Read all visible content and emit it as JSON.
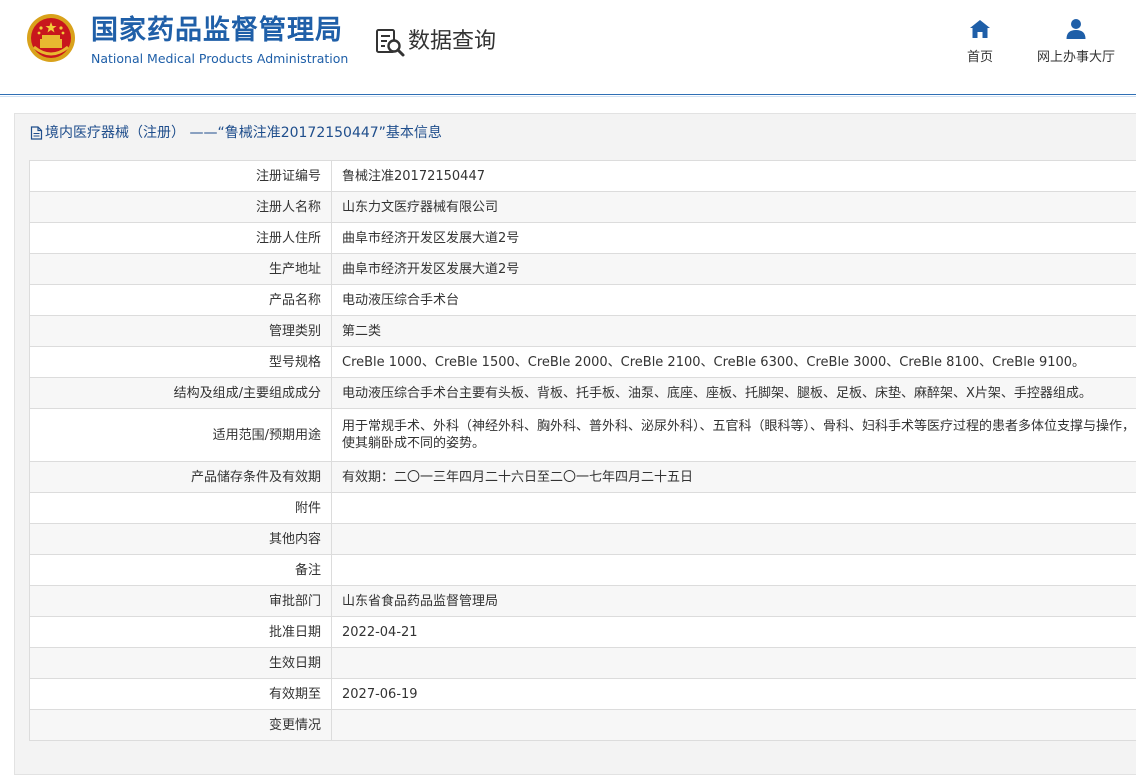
{
  "header": {
    "logo_cn": "国家药品监督管理局",
    "logo_en": "National Medical Products Administration",
    "query_label": "数据查询",
    "nav": [
      {
        "label": "首页",
        "icon": "home-icon"
      },
      {
        "label": "网上办事大厅",
        "icon": "user-icon"
      }
    ],
    "brand_color": "#1f5fa8"
  },
  "panel": {
    "title": "境内医疗器械（注册） ——“鲁械注准20172150447”基本信息"
  },
  "rows": [
    {
      "label": "注册证编号",
      "value": "鲁械注准20172150447"
    },
    {
      "label": "注册人名称",
      "value": "山东力文医疗器械有限公司"
    },
    {
      "label": "注册人住所",
      "value": "曲阜市经济开发区发展大道2号"
    },
    {
      "label": "生产地址",
      "value": "曲阜市经济开发区发展大道2号"
    },
    {
      "label": "产品名称",
      "value": "电动液压综合手术台"
    },
    {
      "label": "管理类别",
      "value": "第二类"
    },
    {
      "label": "型号规格",
      "value": "CreBle 1000、CreBle 1500、CreBle 2000、CreBle 2100、CreBle 6300、CreBle 3000、CreBle 8100、CreBle 9100。"
    },
    {
      "label": "结构及组成/主要组成成分",
      "value": "电动液压综合手术台主要有头板、背板、托手板、油泵、底座、座板、托脚架、腿板、足板、床垫、麻醉架、X片架、手控器组成。"
    },
    {
      "label": "适用范围/预期用途",
      "value": "用于常规手术、外科（神经外科、胸外科、普外科、泌尿外科）、五官科（眼科等）、骨科、妇科手术等医疗过程的患者多体位支撑与操作，使其躺卧成不同的姿势。"
    },
    {
      "label": "产品储存条件及有效期",
      "value": "有效期：二〇一三年四月二十六日至二〇一七年四月二十五日"
    },
    {
      "label": "附件",
      "value": ""
    },
    {
      "label": "其他内容",
      "value": ""
    },
    {
      "label": "备注",
      "value": ""
    },
    {
      "label": "审批部门",
      "value": "山东省食品药品监督管理局"
    },
    {
      "label": "批准日期",
      "value": "2022-04-21"
    },
    {
      "label": "生效日期",
      "value": ""
    },
    {
      "label": "有效期至",
      "value": "2027-06-19"
    },
    {
      "label": "变更情况",
      "value": ""
    }
  ]
}
